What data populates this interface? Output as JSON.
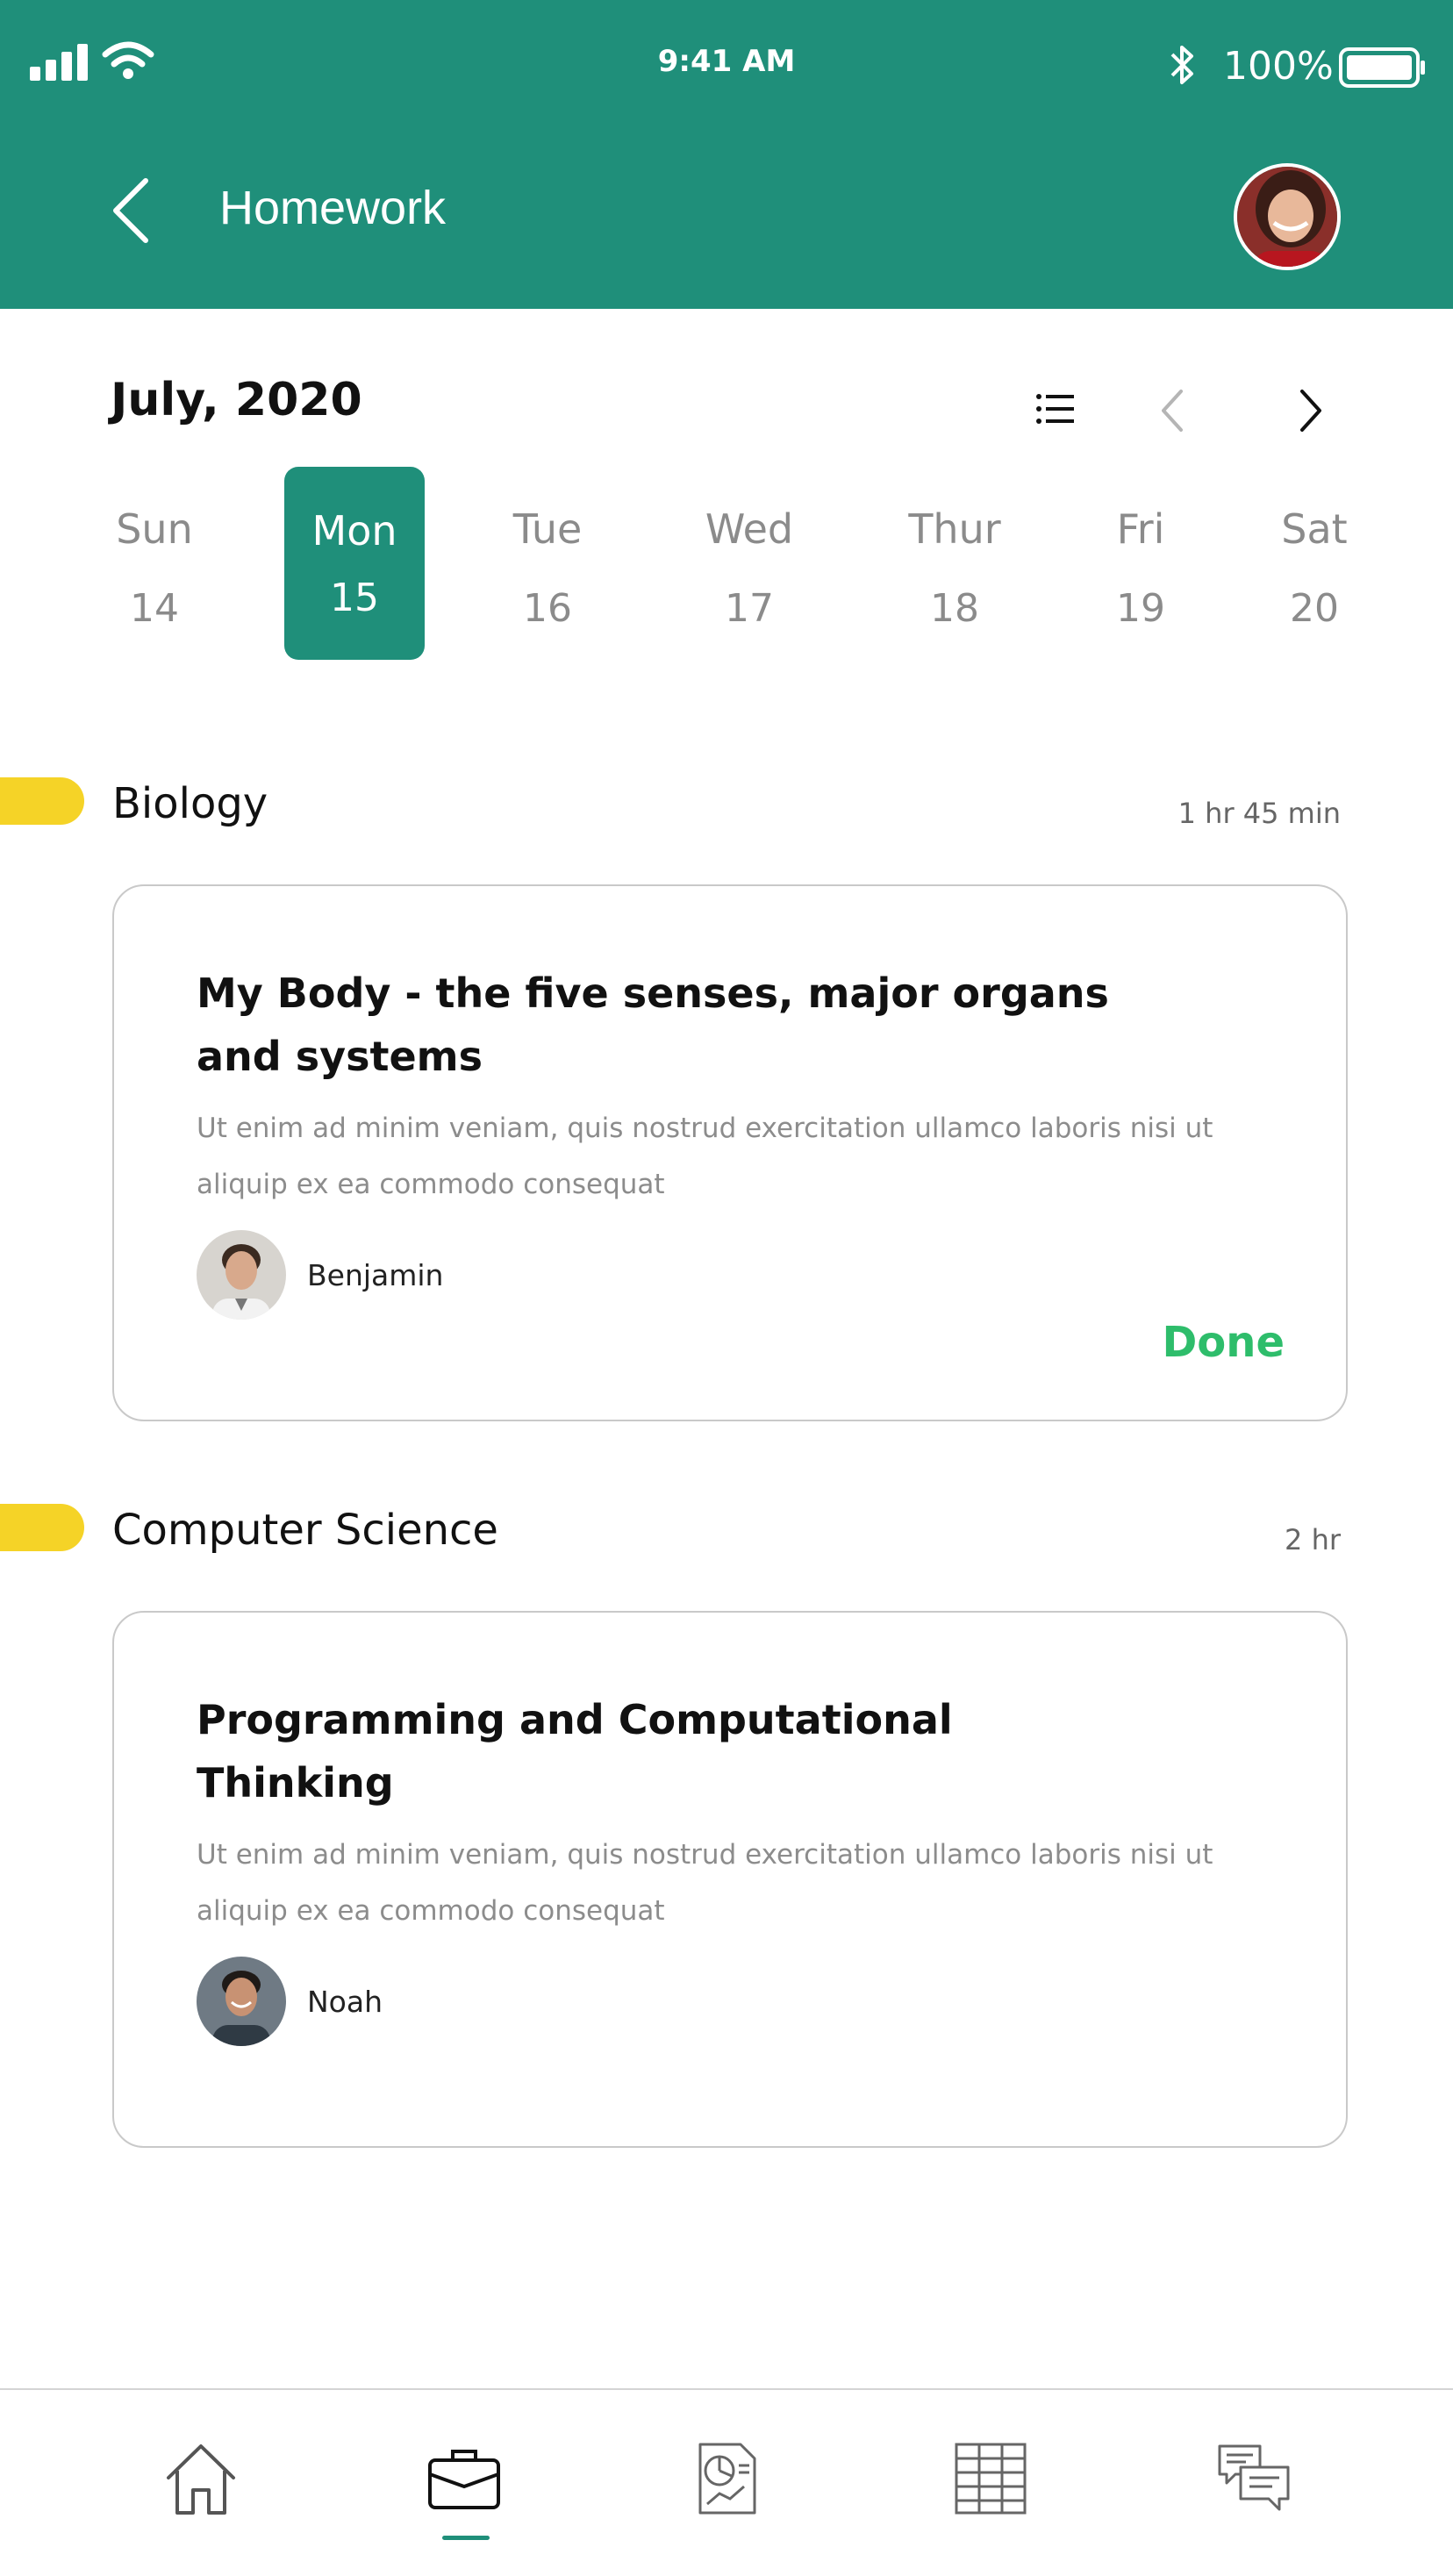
{
  "status_bar": {
    "time": "9:41 AM",
    "battery_percent": "100%"
  },
  "header": {
    "title": "Homework"
  },
  "calendar": {
    "month": "July, 2020",
    "days": [
      {
        "name": "Sun",
        "date": "14",
        "selected": false
      },
      {
        "name": "Mon",
        "date": "15",
        "selected": true
      },
      {
        "name": "Tue",
        "date": "16",
        "selected": false
      },
      {
        "name": "Wed",
        "date": "17",
        "selected": false
      },
      {
        "name": "Thur",
        "date": "18",
        "selected": false
      },
      {
        "name": "Fri",
        "date": "19",
        "selected": false
      },
      {
        "name": "Sat",
        "date": "20",
        "selected": false
      }
    ]
  },
  "subjects": [
    {
      "name": "Biology",
      "duration": "1 hr 45 min",
      "assignment": {
        "title": "My Body - the five senses, major organs and systems",
        "description": "Ut enim ad minim veniam, quis nostrud exercitation ullamco laboris nisi ut aliquip ex ea commodo consequat",
        "author": "Benjamin",
        "status": "Done"
      }
    },
    {
      "name": "Computer Science",
      "duration": "2 hr",
      "assignment": {
        "title": "Programming and Computational Thinking",
        "description": "Ut enim ad minim veniam, quis nostrud exercitation ullamco laboris nisi ut aliquip ex ea commodo consequat",
        "author": "Noah",
        "status": ""
      }
    }
  ],
  "tab_bar": {
    "active_tab": "homework",
    "tabs": [
      {
        "icon": "home-icon"
      },
      {
        "icon": "briefcase-icon"
      },
      {
        "icon": "report-icon"
      },
      {
        "icon": "timetable-icon"
      },
      {
        "icon": "chat-icon"
      }
    ]
  },
  "colors": {
    "primary": "#1f8f7a",
    "accent_pill": "#f5d327",
    "done": "#2ebd6b"
  }
}
